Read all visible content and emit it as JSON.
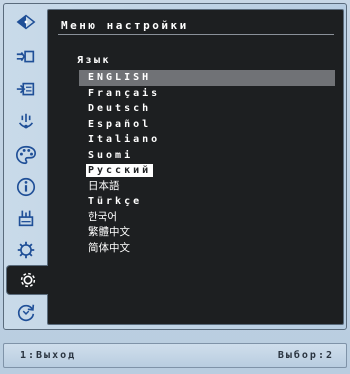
{
  "menu": {
    "title": "Меню настройки",
    "section_label": "Язык",
    "languages": [
      "ENGLISH",
      "Français",
      "Deutsch",
      "Español",
      "Italiano",
      "Suomi",
      "Русский",
      "日本語",
      "Türkçe",
      "한국어",
      "繁體中文",
      "简体中文"
    ],
    "highlighted": "ENGLISH",
    "selected": "Русский"
  },
  "sidebar": {
    "icons": [
      "brightness-contrast-icon",
      "input-source-icon",
      "picture-adjust-icon",
      "color-temperature-icon",
      "color-palette-icon",
      "information-icon",
      "picture-mode-icon",
      "system-setup-icon",
      "settings-gear-icon",
      "reset-icon"
    ],
    "active": "settings-gear-icon"
  },
  "footer": {
    "exit_hint": "1:Выход",
    "select_hint": "Выбор:2"
  },
  "colors": {
    "frame": "#c7d7e6",
    "panel": "#1d1f21",
    "highlight_row": "#707276",
    "icon_blue": "#1f4f97"
  }
}
